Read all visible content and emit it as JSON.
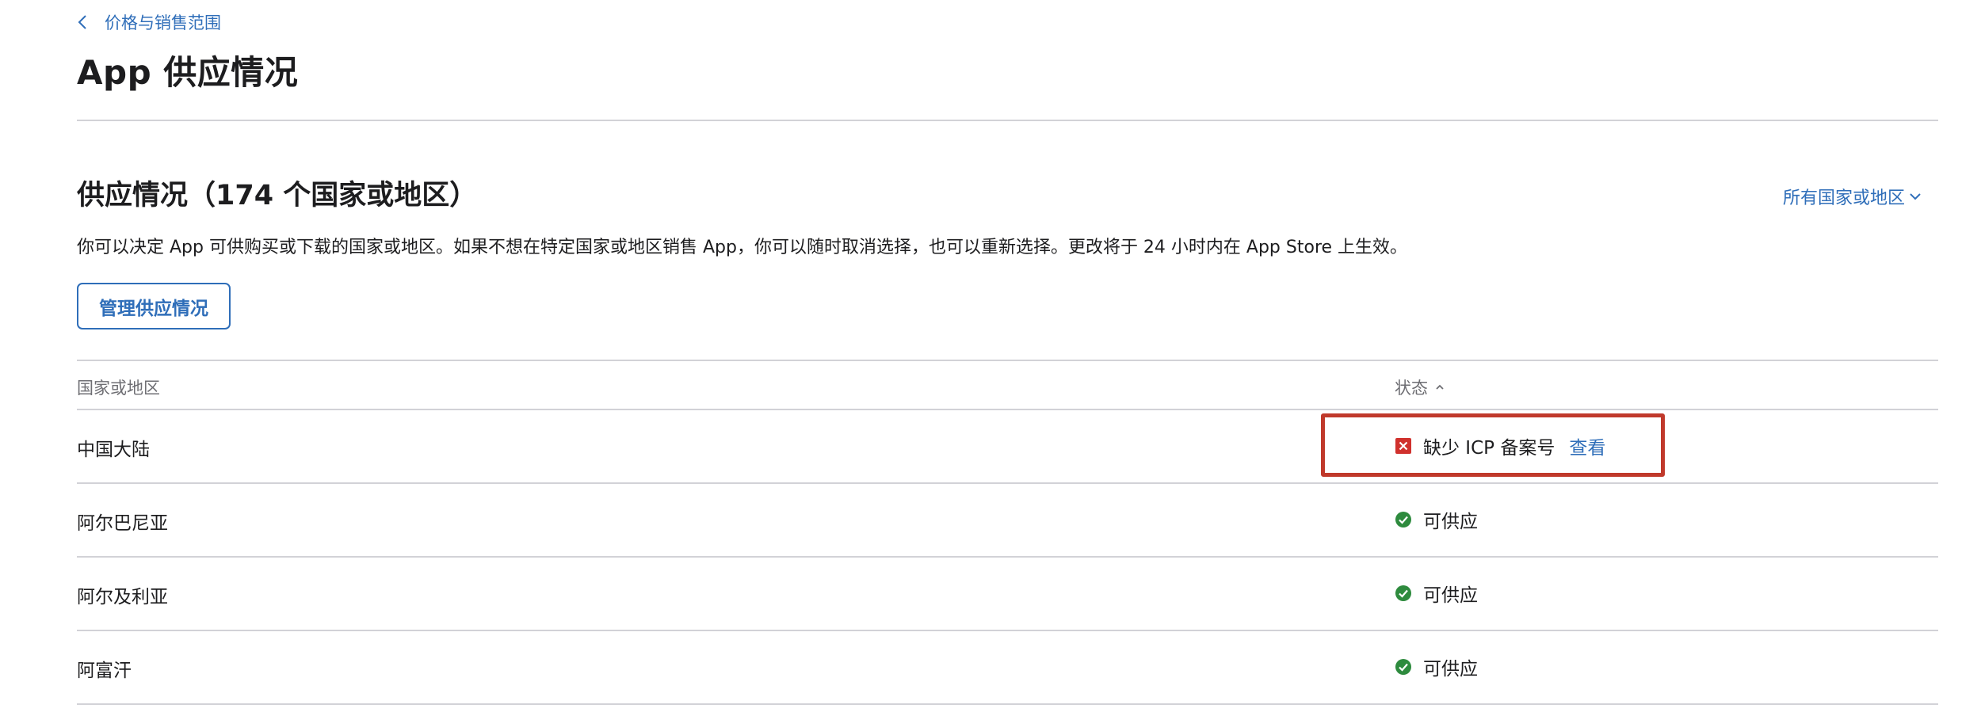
{
  "breadcrumb": {
    "label": "价格与销售范围"
  },
  "page_title": "App 供应情况",
  "section": {
    "title": "供应情况（174 个国家或地区）",
    "description": "你可以决定 App 可供购买或下载的国家或地区。如果不想在特定国家或地区销售 App，你可以随时取消选择，也可以重新选择。更改将于 24 小时内在 App Store 上生效。",
    "filter_label": "所有国家或地区",
    "manage_button": "管理供应情况"
  },
  "table": {
    "headers": {
      "country": "国家或地区",
      "status": "状态"
    },
    "rows": [
      {
        "country": "中国大陆",
        "status": "缺少 ICP 备案号",
        "status_type": "error",
        "action": "查看"
      },
      {
        "country": "阿尔巴尼亚",
        "status": "可供应",
        "status_type": "ok"
      },
      {
        "country": "阿尔及利亚",
        "status": "可供应",
        "status_type": "ok"
      },
      {
        "country": "阿富汗",
        "status": "可供应",
        "status_type": "ok"
      }
    ]
  },
  "colors": {
    "accent": "#2f6eb9",
    "error": "#d0312d",
    "ok": "#2e8b3e",
    "highlight": "#c0392b"
  },
  "icons": [
    "chevron-left-icon",
    "chevron-down-icon",
    "chevron-up-icon",
    "error-x-icon",
    "check-circle-icon"
  ]
}
